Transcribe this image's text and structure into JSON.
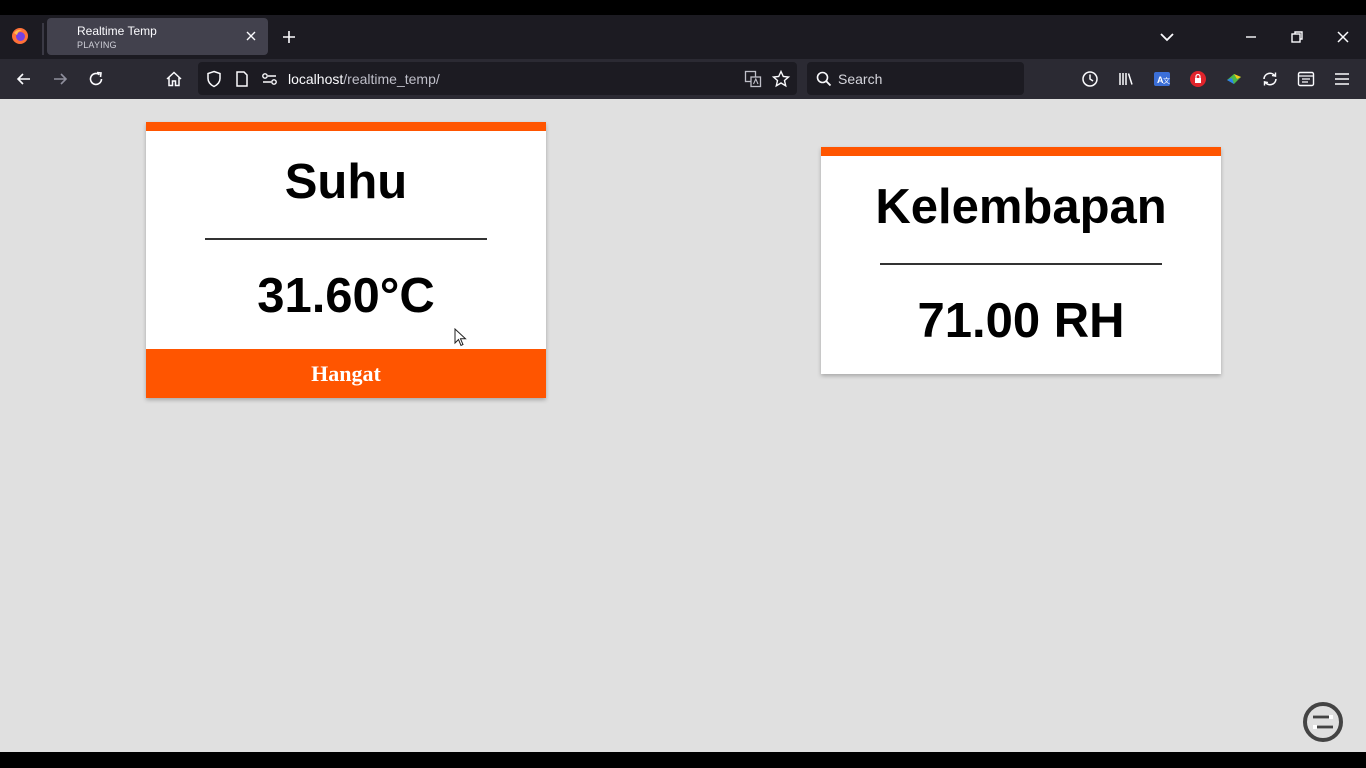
{
  "browser": {
    "tab": {
      "title": "Realtime Temp",
      "subtitle": "PLAYING"
    },
    "url": {
      "host": "localhost",
      "path": "/realtime_temp/"
    },
    "search": {
      "placeholder": "Search"
    }
  },
  "colors": {
    "accent": "#ff5500",
    "page_bg": "#e0e0e0",
    "card_bg": "#ffffff"
  },
  "cards": {
    "temperature": {
      "title": "Suhu",
      "value": "31.60°C",
      "status": "Hangat"
    },
    "humidity": {
      "title": "Kelembapan",
      "value": "71.00 RH"
    }
  }
}
